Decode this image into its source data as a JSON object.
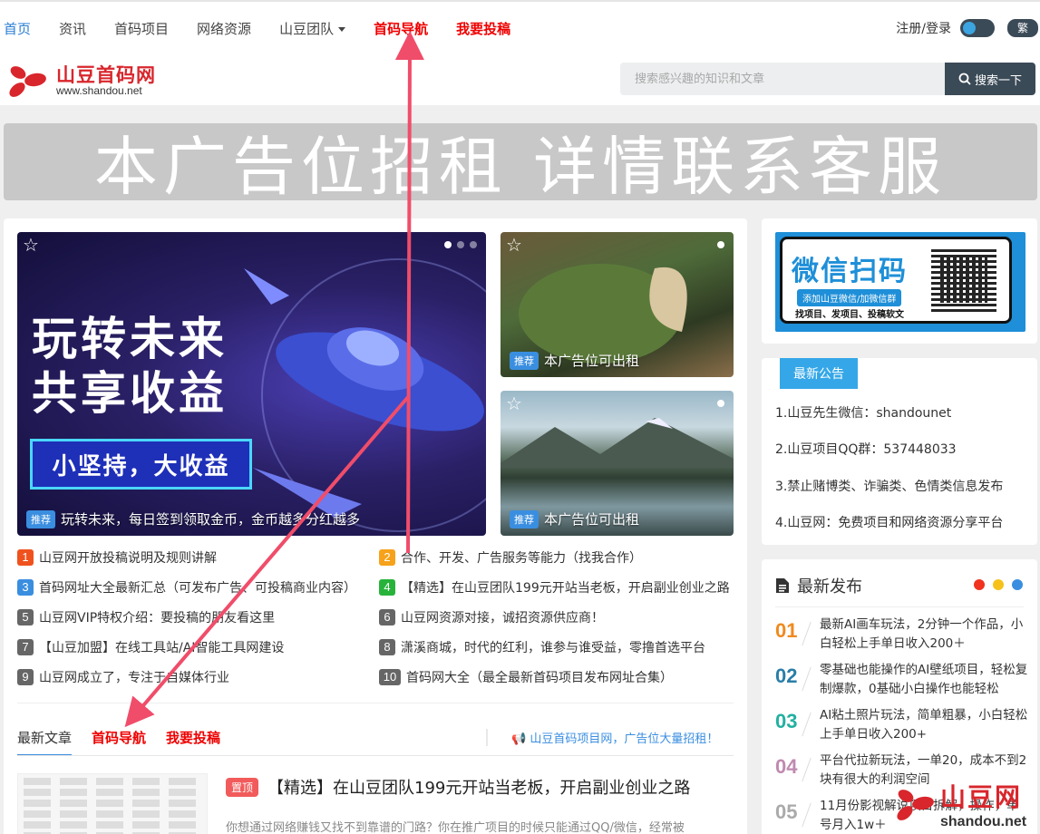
{
  "nav": {
    "items": [
      {
        "label": "首页",
        "style": "active"
      },
      {
        "label": "资讯",
        "style": ""
      },
      {
        "label": "首码项目",
        "style": ""
      },
      {
        "label": "网络资源",
        "style": ""
      },
      {
        "label": "山豆团队",
        "style": "dropdown"
      },
      {
        "label": "首码导航",
        "style": "red"
      },
      {
        "label": "我要投稿",
        "style": "red"
      }
    ],
    "login": "注册/登录",
    "traditional": "繁"
  },
  "header": {
    "logo_title": "山豆首码网",
    "logo_url": "www.shandou.net",
    "search_placeholder": "搜索感兴趣的知识和文章",
    "search_button": "搜索一下"
  },
  "ad_banner": "本广告位招租  详情联系客服",
  "slides": {
    "main": {
      "line1": "玩转未来",
      "line2": "共享收益",
      "promo": "小坚持，大收益",
      "tag": "推荐",
      "caption": "玩转未来，每日签到领取金币，金币越多分红越多"
    },
    "side1": {
      "tag": "推荐",
      "caption": "本广告位可出租"
    },
    "side2": {
      "tag": "推荐",
      "caption": "本广告位可出租"
    }
  },
  "numbered_list": [
    {
      "num": "1",
      "color": "#f0521e",
      "text": "山豆网开放投稿说明及规则讲解"
    },
    {
      "num": "2",
      "color": "#f6a21a",
      "text": "合作、开发、广告服务等能力（找我合作）"
    },
    {
      "num": "3",
      "color": "#3a8ee0",
      "text": "首码网址大全最新汇总（可发布广告、可投稿商业内容）"
    },
    {
      "num": "4",
      "color": "#27b33a",
      "text": "【精选】在山豆团队199元开站当老板，开启副业创业之路"
    },
    {
      "num": "5",
      "color": "#666666",
      "text": "山豆网VIP特权介绍：要投稿的朋友看这里"
    },
    {
      "num": "6",
      "color": "#666666",
      "text": "山豆网资源对接，诚招资源供应商！"
    },
    {
      "num": "7",
      "color": "#666666",
      "text": "【山豆加盟】在线工具站/AI智能工具网建设"
    },
    {
      "num": "8",
      "color": "#666666",
      "text": "潇溪商城，时代的红利，谁参与谁受益，零撸首选平台"
    },
    {
      "num": "9",
      "color": "#666666",
      "text": "山豆网成立了，专注于自媒体行业"
    },
    {
      "num": "10",
      "color": "#666666",
      "text": "首码网大全（最全最新首码项目发布网址合集）"
    }
  ],
  "tabs": [
    {
      "label": "最新文章",
      "style": "active"
    },
    {
      "label": "首码导航",
      "style": "red"
    },
    {
      "label": "我要投稿",
      "style": "red"
    }
  ],
  "tab_notice": "山豆首码项目网，广告位大量招租！",
  "article": {
    "tag": "置顶",
    "title": "【精选】在山豆团队199元开站当老板，开启副业创业之路",
    "excerpt": "你想通过网络赚钱又找不到靠谱的门路？你在推广项目的时候只能通过QQ/微信，经常被"
  },
  "wechat_card": {
    "title": "微信扫码",
    "sub1": "添加山豆微信/加微信群",
    "sub2": "找项目、发项目、投稿软文"
  },
  "notice": {
    "heading": "最新公告",
    "items": [
      "1.山豆先生微信：shandounet",
      "2.山豆项目QQ群：537448033",
      "3.禁止赌博类、诈骗类、色情类信息发布",
      "4.山豆网：免费项目和网络资源分享平台"
    ]
  },
  "latest": {
    "heading": "最新发布",
    "dot_colors": [
      "#f0321e",
      "#f6c21a",
      "#3a8ee0"
    ],
    "items": [
      {
        "num": "01",
        "color": "#f08a1e",
        "text": "最新AI画车玩法，2分钟一个作品，小白轻松上手单日收入200＋"
      },
      {
        "num": "02",
        "color": "#2a7ea8",
        "text": "零基础也能操作的AI壁纸项目，轻松复制爆款，0基础小白操作也能轻松"
      },
      {
        "num": "03",
        "color": "#22b0a0",
        "text": "AI粘土照片玩法，简单粗暴，小白轻松上手单日收入200+"
      },
      {
        "num": "04",
        "color": "#c08ab0",
        "text": "平台代拉新玩法，一单20，成本不到2块有很大的利润空间"
      },
      {
        "num": "05",
        "color": "#aaaaaa",
        "text": "11月份影视解说项目拆解，操作，单号月入1w＋"
      }
    ]
  },
  "watermark": {
    "title": "山豆网",
    "url": "shandou.net"
  }
}
